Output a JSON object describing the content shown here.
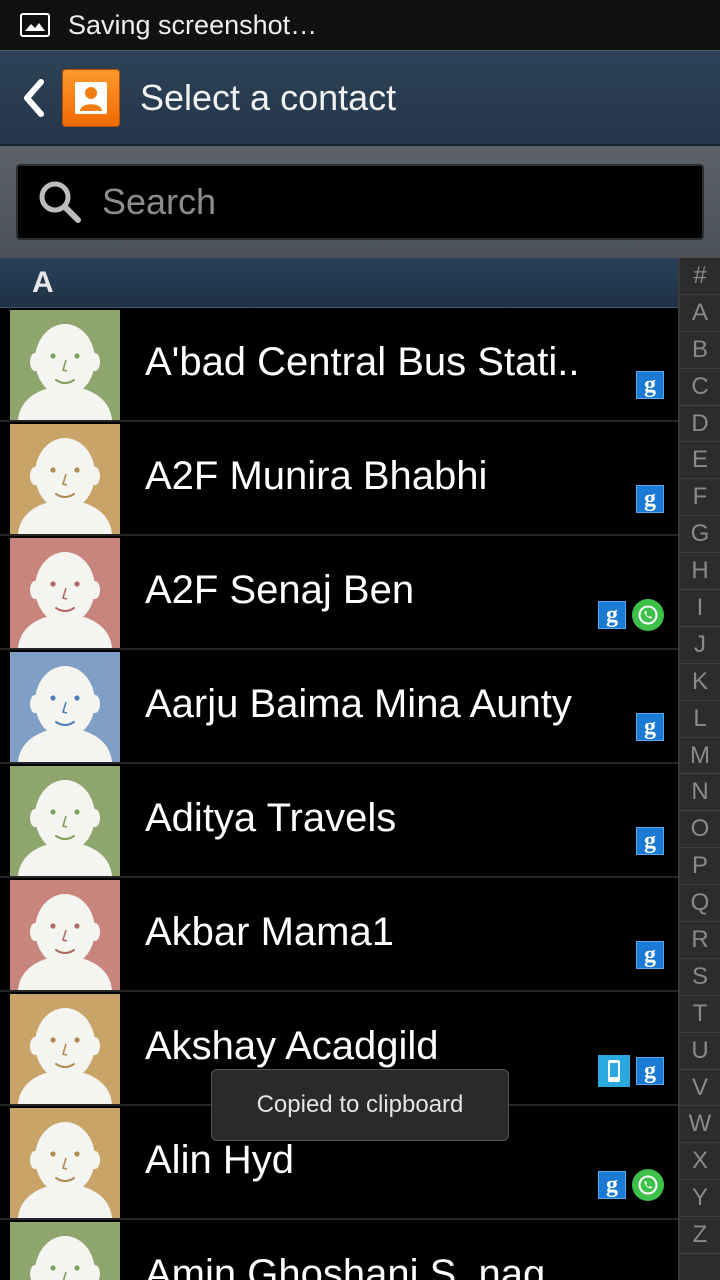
{
  "status_bar": {
    "notification_text": "Saving screenshot…",
    "icon": "image-icon"
  },
  "action_bar": {
    "title": "Select a contact",
    "back_icon": "back-chevron-icon",
    "app_icon": "contacts-icon"
  },
  "search": {
    "placeholder": "Search"
  },
  "section_header": "A",
  "contacts": [
    {
      "name": "A'bad Central Bus Stati..",
      "avatar_color": "#8fa56e",
      "face_tint": "#7aa05a",
      "badges": [
        "google"
      ]
    },
    {
      "name": "A2F Munira Bhabhi",
      "avatar_color": "#c9a469",
      "face_tint": "#b08a50",
      "badges": [
        "google"
      ]
    },
    {
      "name": "A2F Senaj Ben",
      "avatar_color": "#c8857d",
      "face_tint": "#b06a62",
      "badges": [
        "google",
        "whatsapp"
      ]
    },
    {
      "name": "Aarju Baima Mina Aunty",
      "avatar_color": "#7f9fc4",
      "face_tint": "#4f7fb8",
      "badges": [
        "google"
      ]
    },
    {
      "name": "Aditya Travels",
      "avatar_color": "#8fa56e",
      "face_tint": "#7aa05a",
      "badges": [
        "google"
      ]
    },
    {
      "name": "Akbar Mama1",
      "avatar_color": "#c8857d",
      "face_tint": "#b06a62",
      "badges": [
        "google"
      ]
    },
    {
      "name": "Akshay Acadgild",
      "avatar_color": "#c9a469",
      "face_tint": "#b08a50",
      "badges": [
        "phone",
        "google"
      ]
    },
    {
      "name": "Alin Hyd",
      "avatar_color": "#c9a469",
      "face_tint": "#b08a50",
      "badges": [
        "google",
        "whatsapp"
      ]
    },
    {
      "name": "Amin Ghoshani S. nag",
      "avatar_color": "#8fa56e",
      "face_tint": "#7aa05a",
      "badges": []
    }
  ],
  "index_letters": [
    "#",
    "A",
    "B",
    "C",
    "D",
    "E",
    "F",
    "G",
    "H",
    "I",
    "J",
    "K",
    "L",
    "M",
    "N",
    "O",
    "P",
    "Q",
    "R",
    "S",
    "T",
    "U",
    "V",
    "W",
    "X",
    "Y",
    "Z"
  ],
  "toast": "Copied to clipboard",
  "colors": {
    "google_badge": "#1a7ad4",
    "whatsapp_badge": "#3ec14b",
    "phone_badge": "#2aa9e0",
    "app_icon": "#f07d10"
  }
}
